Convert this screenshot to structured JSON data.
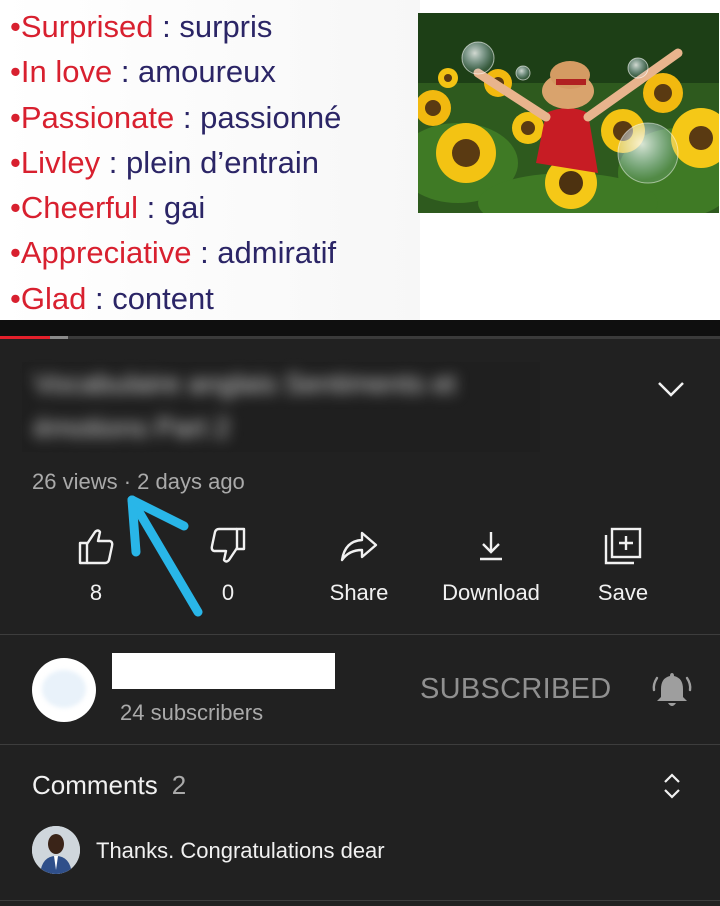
{
  "video": {
    "vocab": [
      {
        "en": "•Surprised",
        "sep": " : ",
        "fr": "surpris"
      },
      {
        "en": "•In love",
        "sep": " : ",
        "fr": "amoureux"
      },
      {
        "en": "•Passionate",
        "sep": " : ",
        "fr": "passionné"
      },
      {
        "en": "•Livley",
        "sep": " : ",
        "fr": "plein d’entrain"
      },
      {
        "en": "•Cheerful",
        "sep": " : ",
        "fr": "gai"
      },
      {
        "en": "•Appreciative",
        "sep": " : ",
        "fr": "admiratif"
      },
      {
        "en": "•Glad",
        "sep": " : ",
        "fr": "content"
      }
    ],
    "progress": {
      "played_fraction": 0.07,
      "buffered_fraction": 0.095
    },
    "accent_red": "#d8202f",
    "text_navy": "#2b2566"
  },
  "info": {
    "title_blurred": "Vocabulaire anglais Sentiments et émotions Part 2",
    "views": "26 views",
    "separator": " · ",
    "age": "2 days ago"
  },
  "actions": {
    "like": {
      "icon": "thumbs-up-icon",
      "label": "8"
    },
    "dislike": {
      "icon": "thumbs-down-icon",
      "label": "0"
    },
    "share": {
      "icon": "share-icon",
      "label": "Share"
    },
    "download": {
      "icon": "download-icon",
      "label": "Download"
    },
    "save": {
      "icon": "add-to-playlist-icon",
      "label": "Save"
    }
  },
  "channel": {
    "subscribers": "24 subscribers",
    "subscribe_label": "SUBSCRIBED",
    "bell_icon": "bell-icon"
  },
  "comments": {
    "heading": "Comments",
    "count": "2",
    "top_comment": "Thanks.  Congratulations dear"
  },
  "annotation_color": "#29b6e8"
}
